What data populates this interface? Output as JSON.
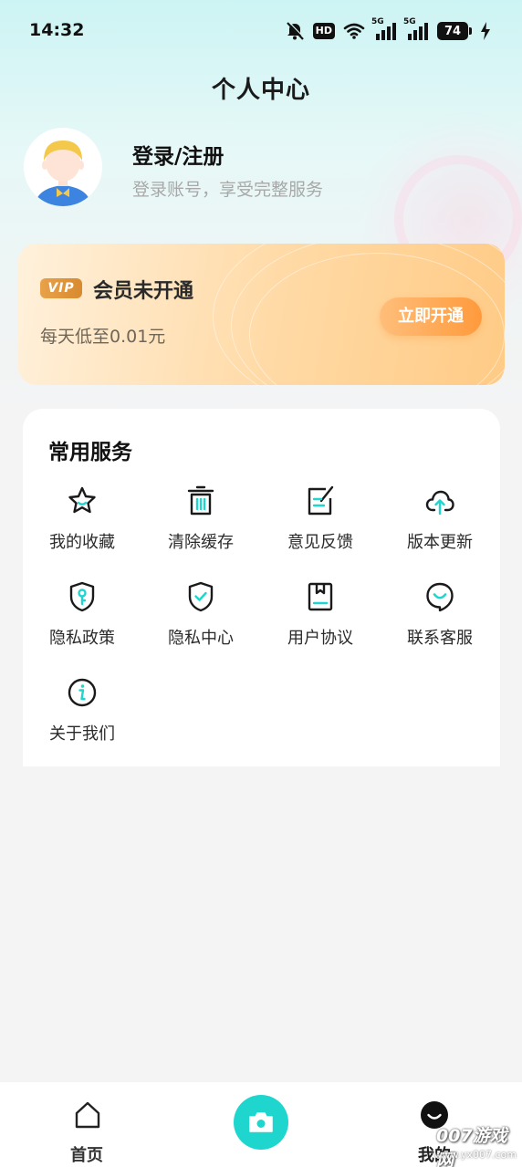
{
  "status_bar": {
    "time": "14:32",
    "hd_label": "HD",
    "signal_1_label": "5G",
    "signal_2_label": "5G",
    "battery": "74"
  },
  "header": {
    "title": "个人中心"
  },
  "profile": {
    "title": "登录/注册",
    "subtitle": "登录账号，享受完整服务"
  },
  "vip": {
    "badge": "VIP",
    "status": "会员未开通",
    "price_text": "每天低至0.01元",
    "button": "立即开通"
  },
  "services": {
    "title": "常用服务",
    "items": [
      {
        "label": "我的收藏",
        "icon": "star-icon"
      },
      {
        "label": "清除缓存",
        "icon": "trash-icon"
      },
      {
        "label": "意见反馈",
        "icon": "edit-note-icon"
      },
      {
        "label": "版本更新",
        "icon": "cloud-upload-icon"
      },
      {
        "label": "隐私政策",
        "icon": "shield-key-icon"
      },
      {
        "label": "隐私中心",
        "icon": "shield-check-icon"
      },
      {
        "label": "用户协议",
        "icon": "book-icon"
      },
      {
        "label": "联系客服",
        "icon": "chat-smile-icon"
      },
      {
        "label": "关于我们",
        "icon": "info-icon"
      }
    ]
  },
  "bottom_nav": {
    "home": "首页",
    "mine": "我的"
  },
  "watermark": {
    "brand": "007游戏网",
    "url": "www.yx007.com"
  },
  "colors": {
    "accent": "#1fd6cf",
    "vip_button": "#ff9a3c",
    "vip_badge": "#e09a42"
  }
}
